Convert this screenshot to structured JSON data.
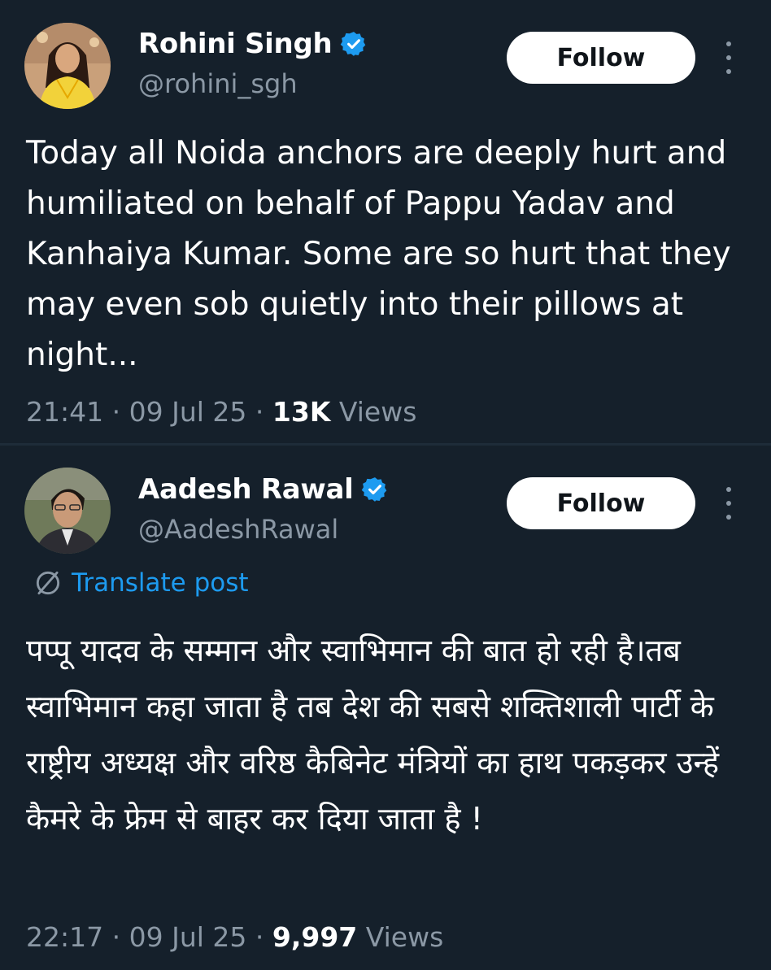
{
  "tweets": [
    {
      "author_name": "Rohini Singh",
      "handle": "@rohini_sgh",
      "follow_label": "Follow",
      "text": "Today all Noida anchors are deeply hurt and humiliated on behalf of Pappu Yadav and Kanhaiya Kumar. Some are so hurt that they may even sob quietly into their pillows at night...",
      "time": "21:41",
      "date": "09 Jul 25",
      "views_count": "13K",
      "views_label": "Views",
      "separator": "·"
    },
    {
      "author_name": "Aadesh Rawal",
      "handle": "@AadeshRawal",
      "follow_label": "Follow",
      "translate_label": "Translate post",
      "text": "पप्पू यादव के सम्मान और स्वाभिमान की बात हो रही है।तब स्वाभिमान कहा जाता है तब देश की सबसे शक्तिशाली पार्टी के राष्ट्रीय अध्यक्ष और वरिष्ठ कैबिनेट मंत्रियों का हाथ पकड़कर उन्हें कैमरे के फ्रेम से बाहर कर दिया जाता है !",
      "time": "22:17",
      "date": "09 Jul 25",
      "views_count": "9,997",
      "views_label": "Views",
      "separator": "·"
    }
  ],
  "icons": {
    "verified": "verified-badge-icon",
    "more": "more-vertical-icon",
    "translate": "translate-globe-icon"
  },
  "colors": {
    "background": "#15202b",
    "secondary_text": "#8b98a5",
    "verified_blue": "#1d9bf0",
    "follow_bg": "#ffffff"
  }
}
